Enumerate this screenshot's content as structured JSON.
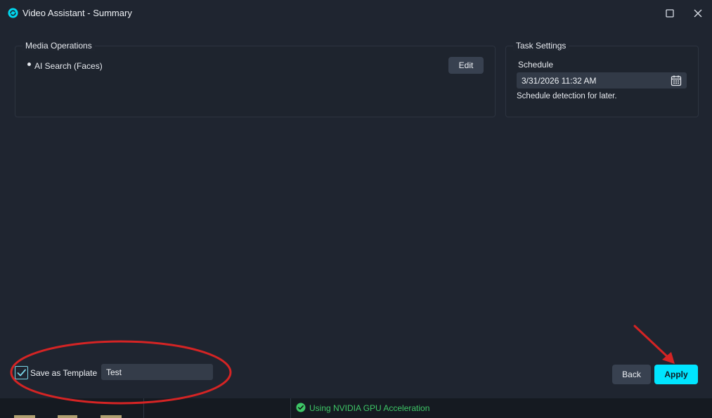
{
  "window": {
    "title": "Video Assistant - Summary",
    "icons": {
      "app": "app-logo-icon",
      "maximize": "maximize-icon",
      "close": "close-icon"
    }
  },
  "media_operations": {
    "legend": "Media Operations",
    "items": [
      "AI Search (Faces)"
    ],
    "edit_label": "Edit"
  },
  "task_settings": {
    "legend": "Task Settings",
    "schedule_label": "Schedule",
    "schedule_value": "3/31/2026 11:32 AM",
    "schedule_help": "Schedule detection for later."
  },
  "template": {
    "checked": true,
    "label": "Save as Template",
    "name_value": "Test"
  },
  "actions": {
    "back_label": "Back",
    "apply_label": "Apply"
  },
  "status": {
    "gpu_text": "Using NVIDIA GPU Acceleration"
  },
  "colors": {
    "accent": "#00e5ff",
    "background": "#1f2530",
    "status_green": "#3ec767",
    "annotation_red": "#d42424"
  }
}
